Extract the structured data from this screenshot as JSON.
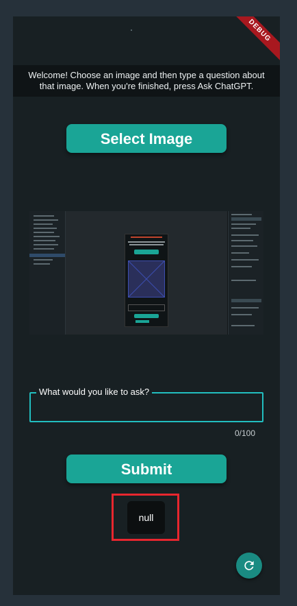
{
  "debug_banner": "DEBUG",
  "welcome_text": "Welcome! Choose an image and then type a question about that image. When you're finished, press Ask ChatGPT.",
  "select_image_label": "Select Image",
  "question_field": {
    "label": "What would you like to ask?",
    "value": "",
    "counter": "0/100"
  },
  "submit_label": "Submit",
  "result_text": "null",
  "icons": {
    "refresh": "refresh-icon"
  },
  "colors": {
    "accent": "#1aa596",
    "field_border": "#22bfc0",
    "highlight": "#e8262e",
    "background": "#182023"
  }
}
